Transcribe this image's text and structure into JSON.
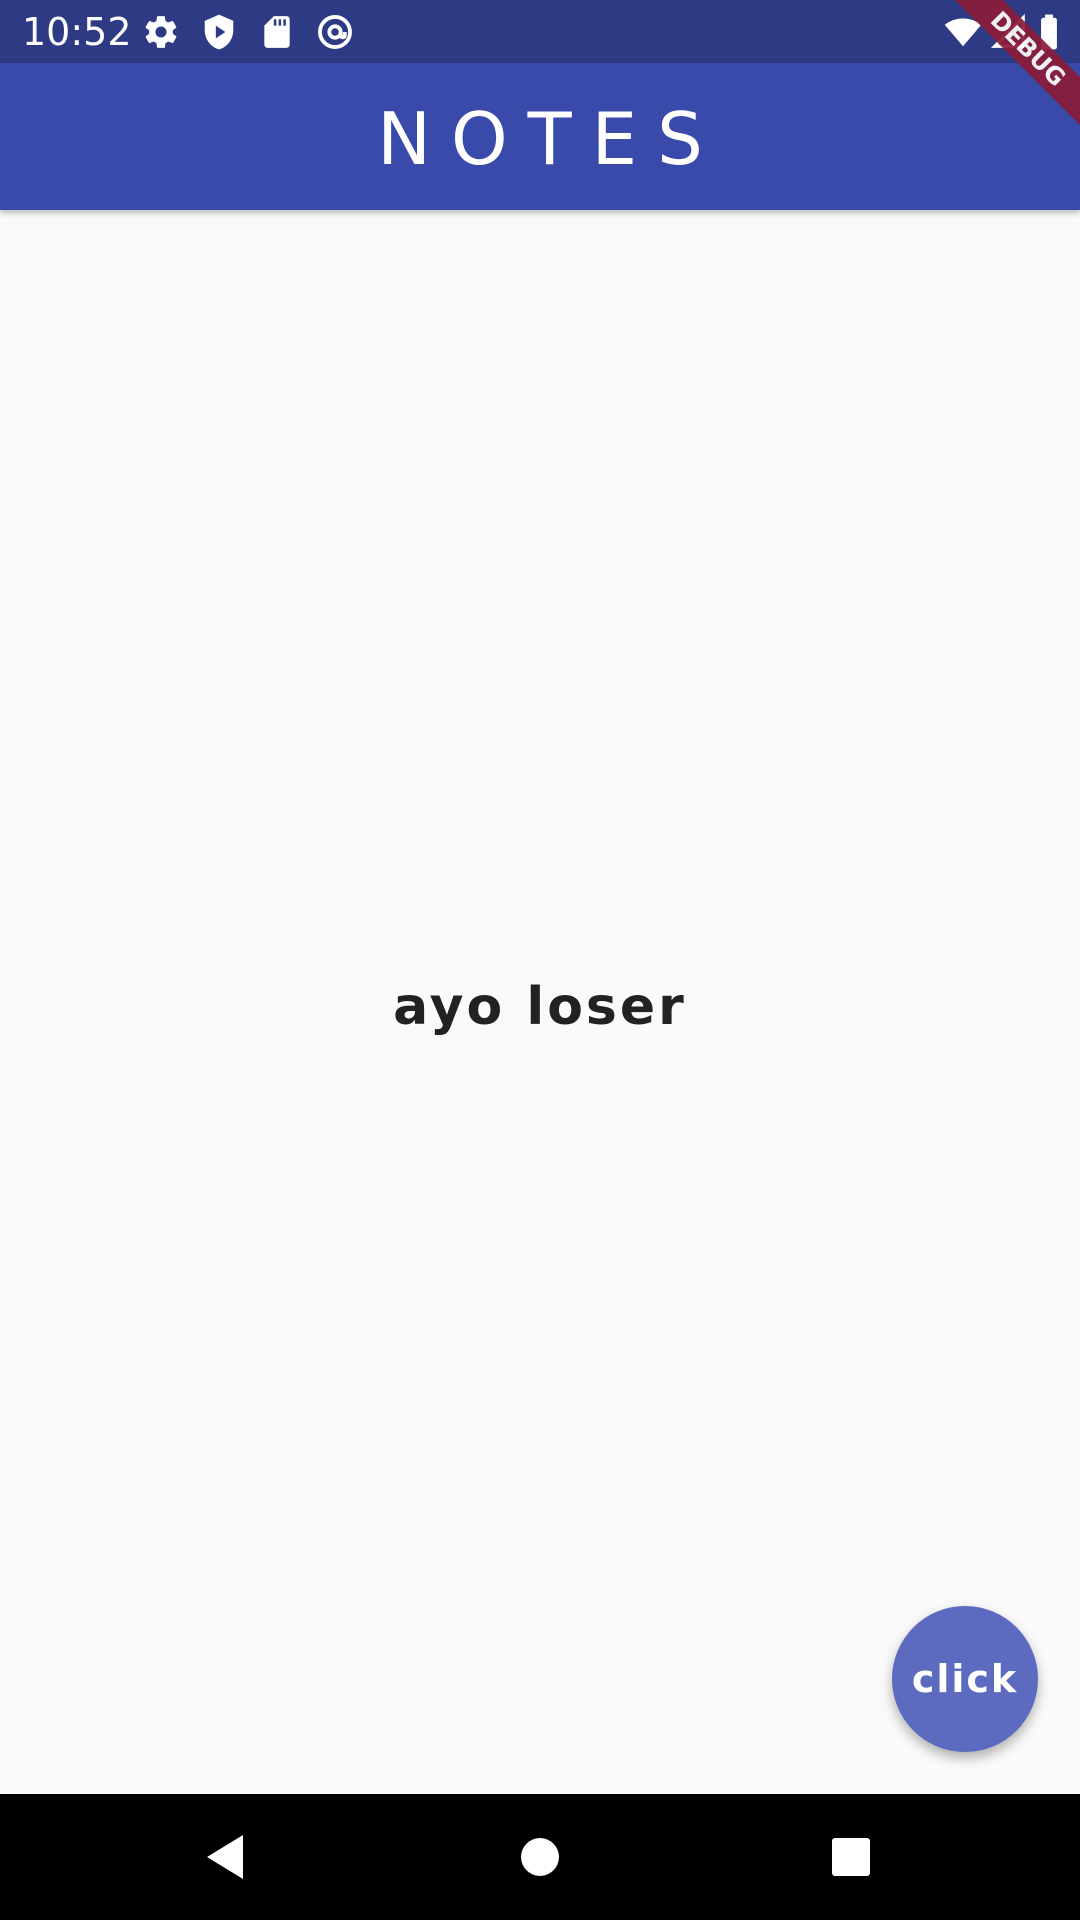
{
  "status_bar": {
    "time": "10:52",
    "left_icons": [
      "gear-icon",
      "shield-play-icon",
      "sd-card-icon",
      "at-sign-icon"
    ],
    "right_icons": [
      "wifi-icon",
      "signal-icon",
      "battery-icon"
    ],
    "background": "#2f3a85"
  },
  "app_bar": {
    "title": "NOTES",
    "background": "#3a4aab"
  },
  "debug_banner": {
    "label": "DEBUG",
    "color": "#8c1c3a"
  },
  "main": {
    "text": "ayo loser"
  },
  "fab": {
    "label": "click",
    "color": "#5c6bc0"
  },
  "nav_bar": {
    "buttons": [
      "back-icon",
      "home-icon",
      "recents-icon"
    ]
  }
}
